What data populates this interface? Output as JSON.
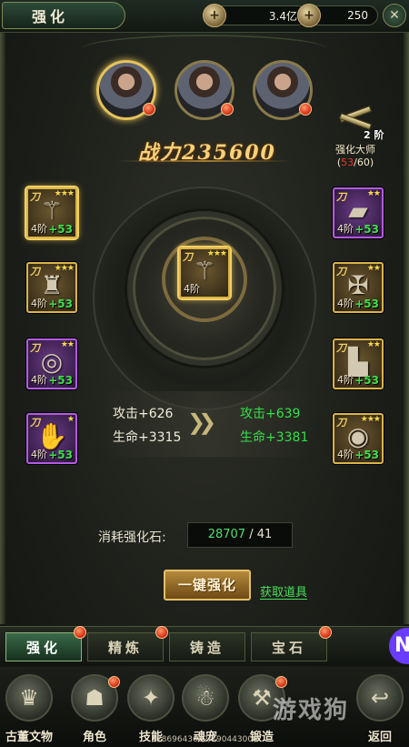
{
  "header": {
    "title": "强化",
    "currency_gold": "3.4亿",
    "currency_ingot": "250"
  },
  "heroes": [
    {
      "name": "hero-1",
      "active": true
    },
    {
      "name": "hero-2",
      "active": false
    },
    {
      "name": "hero-3",
      "active": false
    }
  ],
  "power": {
    "label": "战力",
    "value": "235600"
  },
  "master": {
    "level": "2 阶",
    "label": "强化大师",
    "current": "53",
    "total": "/60)",
    "open": "("
  },
  "slots_left": [
    {
      "icon": "staff",
      "tier": "4阶",
      "bonus": "+53",
      "quality": "gold",
      "stars": "★★★"
    },
    {
      "icon": "armor",
      "tier": "4阶",
      "bonus": "+53",
      "quality": "gold",
      "stars": "★★★"
    },
    {
      "icon": "belt",
      "tier": "4阶",
      "bonus": "+53",
      "quality": "purple",
      "stars": "★★"
    },
    {
      "icon": "glove",
      "tier": "4阶",
      "bonus": "+53",
      "quality": "purple",
      "stars": "★"
    }
  ],
  "slots_right": [
    {
      "icon": "bracer",
      "tier": "4阶",
      "bonus": "+53",
      "quality": "purple",
      "stars": "★★"
    },
    {
      "icon": "necklace",
      "tier": "4阶",
      "bonus": "+53",
      "quality": "gold",
      "stars": "★★"
    },
    {
      "icon": "boots",
      "tier": "4阶",
      "bonus": "+53",
      "quality": "gold",
      "stars": "★★"
    },
    {
      "icon": "ring",
      "tier": "4阶",
      "bonus": "+53",
      "quality": "gold",
      "stars": "★★★"
    }
  ],
  "center_slot": {
    "tier": "4阶",
    "stars": "★★★"
  },
  "stats": {
    "attack_current": "攻击+626",
    "hp_current": "生命+3315",
    "attack_next": "攻击+639",
    "hp_next": "生命+3381"
  },
  "cost": {
    "label": "消耗强化石:",
    "have": "28707",
    "need": " / 41"
  },
  "actions": {
    "one_key": "一键强化",
    "get_items": "获取道具"
  },
  "tabs": [
    "强化",
    "精炼",
    "铸造",
    "宝石"
  ],
  "nav": [
    {
      "label": "古董文物",
      "icon": "antique-icon"
    },
    {
      "label": "角色",
      "icon": "character-icon"
    },
    {
      "label": "技能",
      "icon": "skill-icon"
    },
    {
      "label": "魂宠",
      "icon": "pet-icon"
    },
    {
      "label": "锻造",
      "icon": "forge-icon"
    },
    {
      "label": "返回",
      "icon": "back-icon"
    }
  ],
  "exp_text": "37869643662/190443000",
  "watermark": "游戏狗"
}
